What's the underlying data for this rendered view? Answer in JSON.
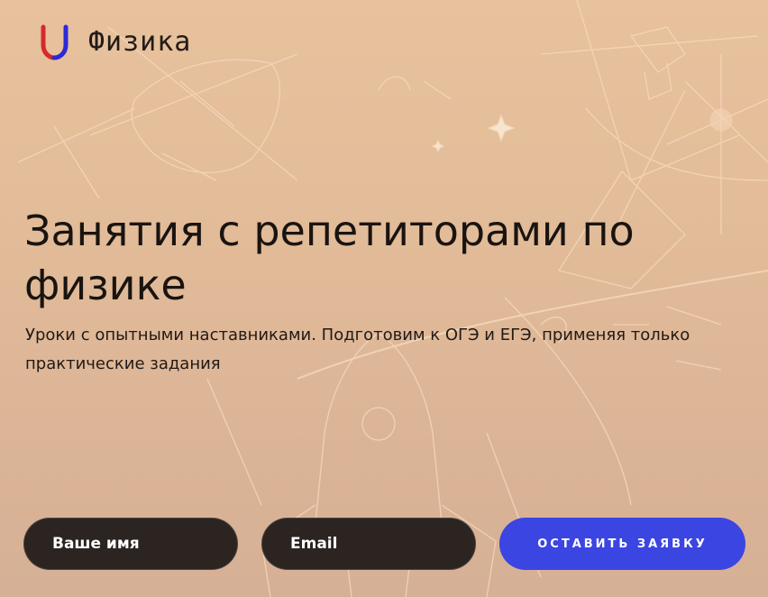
{
  "brand": {
    "logo_text": "Физика",
    "logo_icon": "magnet-icon",
    "colors": {
      "magnet_red": "#d62a2a",
      "magnet_blue": "#2a2ad6"
    }
  },
  "hero": {
    "title": "Занятия с репетиторами по физике",
    "subtitle": "Уроки с опытными наставниками. Подготовим к ОГЭ и ЕГЭ, применяя только практические задания"
  },
  "form": {
    "name_placeholder": "Ваше имя",
    "email_placeholder": "Email",
    "submit_label": "ОСТАВИТЬ ЗАЯВКУ"
  },
  "colors": {
    "accent": "#3b45e2",
    "field_bg": "#2b2420",
    "background": "#e3bc99"
  }
}
